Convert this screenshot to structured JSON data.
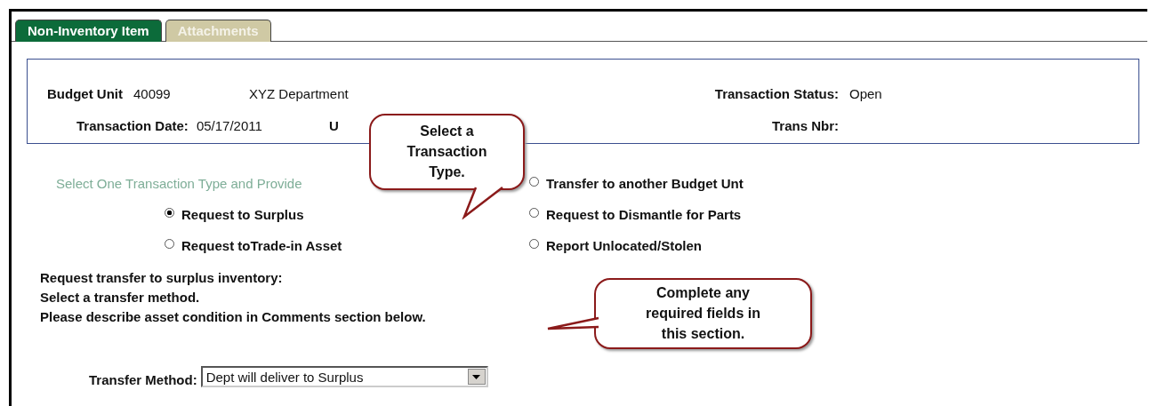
{
  "tabs": [
    {
      "label": "Non-Inventory Item",
      "selected": true
    },
    {
      "label": "Attachments",
      "selected": false
    }
  ],
  "header": {
    "budget_unit": {
      "label": "Budget Unit",
      "value": "40099",
      "description": "XYZ Department"
    },
    "transaction_status": {
      "label": "Transaction Status:",
      "value": "Open"
    },
    "transaction_date": {
      "label": "Transaction Date:",
      "value": "05/17/2011"
    },
    "partial_label": "U",
    "trans_nbr": {
      "label": "Trans Nbr:"
    }
  },
  "transaction_type_heading": "Select One Transaction Type and Provide",
  "left_options": [
    {
      "label": "Request to Surplus",
      "selected": true
    },
    {
      "label": "Request toTrade-in Asset",
      "selected": false
    }
  ],
  "right_options": [
    {
      "label": "Transfer to another Budget Unt",
      "selected": false
    },
    {
      "label": "Request to Dismantle for Parts",
      "selected": false
    },
    {
      "label": "Report Unlocated/Stolen",
      "selected": false
    }
  ],
  "notes": [
    "Request transfer to surplus inventory:",
    "Select a transfer method.",
    "Please describe asset condition in Comments section below."
  ],
  "transfer_method": {
    "label": "Transfer Method:",
    "value": "Dept will deliver to Surplus"
  },
  "callouts": [
    {
      "lines": [
        "Select a",
        "Transaction",
        "Type."
      ]
    },
    {
      "lines": [
        "Complete any",
        "required fields in",
        "this section."
      ]
    }
  ]
}
